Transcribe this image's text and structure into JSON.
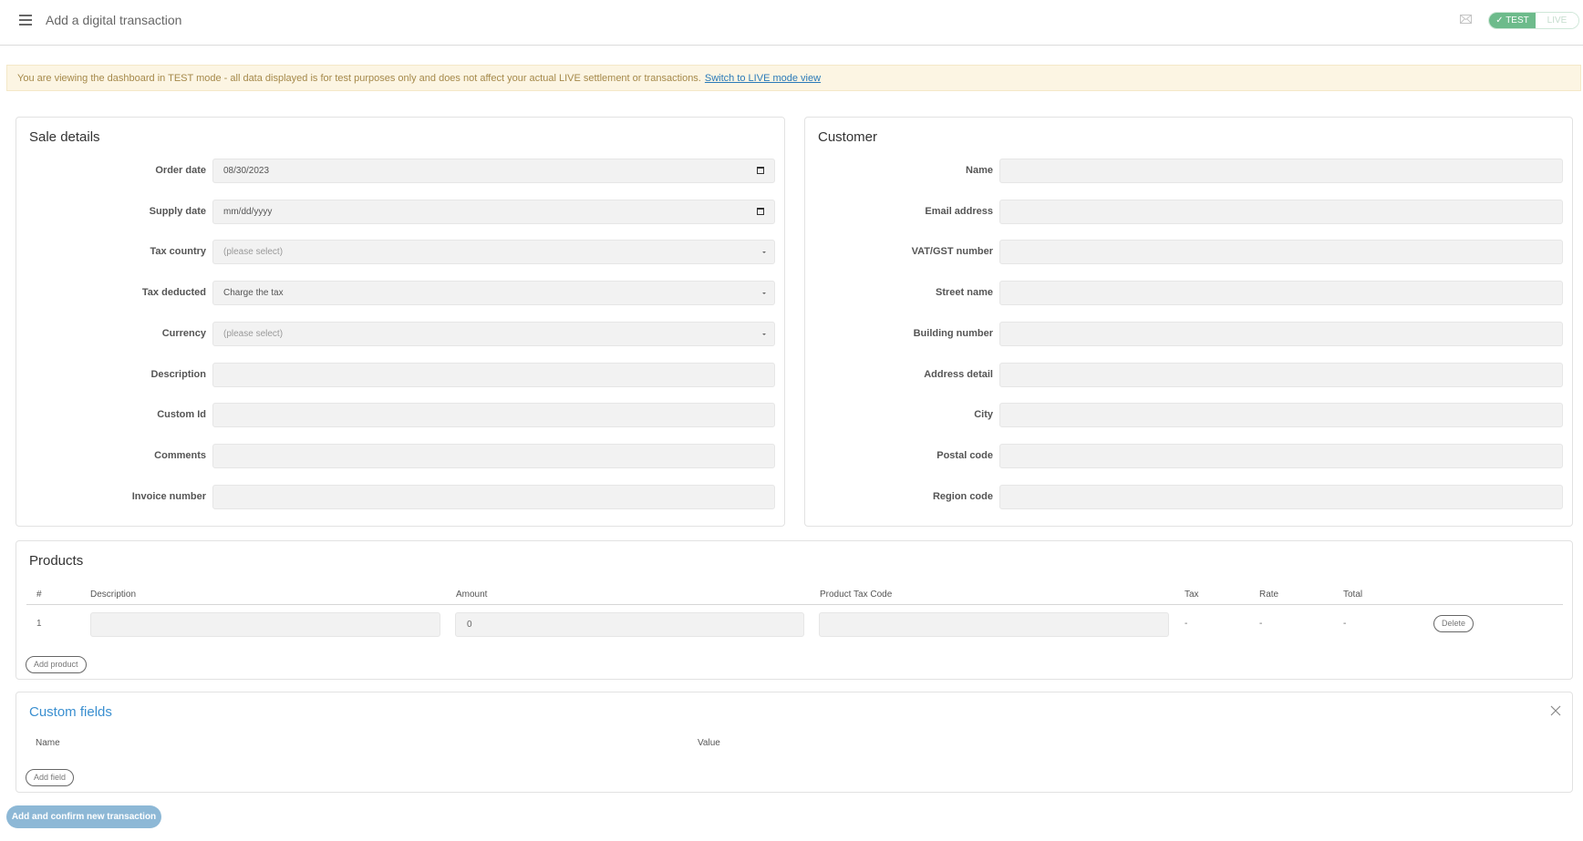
{
  "header": {
    "title": "Add a digital transaction",
    "menu_icon": "hamburger-menu-icon",
    "mail_icon": "envelope-icon",
    "mode_toggle": {
      "test_label": "✓ TEST",
      "live_label": "LIVE",
      "active": "TEST",
      "active_color": "#6dbb8b"
    }
  },
  "banner": {
    "text": "You are viewing the dashboard in TEST mode - all data displayed is for test purposes only and does not affect your actual LIVE settlement or transactions.",
    "link": "Switch to LIVE mode view"
  },
  "sale_details": {
    "title": "Sale details",
    "fields": [
      {
        "label": "Order date",
        "value": "08/30/2023",
        "type": "date"
      },
      {
        "label": "Supply date",
        "value": "mm/dd/yyyy",
        "type": "date"
      },
      {
        "label": "Tax country",
        "value": "(please select)",
        "type": "select"
      },
      {
        "label": "Tax deducted",
        "value": "Charge the tax",
        "type": "select"
      },
      {
        "label": "Currency",
        "value": "(please select)",
        "type": "select"
      },
      {
        "label": "Description",
        "value": "",
        "type": "text"
      },
      {
        "label": "Custom Id",
        "value": "",
        "type": "text"
      },
      {
        "label": "Comments",
        "value": "",
        "type": "text"
      },
      {
        "label": "Invoice number",
        "value": "",
        "type": "text"
      }
    ]
  },
  "customer": {
    "title": "Customer",
    "fields": [
      {
        "label": "Name",
        "value": ""
      },
      {
        "label": "Email address",
        "value": ""
      },
      {
        "label": "VAT/GST number",
        "value": ""
      },
      {
        "label": "Street name",
        "value": ""
      },
      {
        "label": "Building number",
        "value": ""
      },
      {
        "label": "Address detail",
        "value": ""
      },
      {
        "label": "City",
        "value": ""
      },
      {
        "label": "Postal code",
        "value": ""
      },
      {
        "label": "Region code",
        "value": ""
      }
    ]
  },
  "products": {
    "title": "Products",
    "columns": [
      "#",
      "Description",
      "Amount",
      "Product Tax Code",
      "Tax",
      "Rate",
      "Total"
    ],
    "rows": [
      {
        "num": "1",
        "description": "",
        "amount": "0",
        "tax_code": "",
        "tax": "-",
        "rate": "-",
        "total": "-",
        "delete_label": "Delete"
      }
    ],
    "add_label": "Add product"
  },
  "custom_fields": {
    "title": "Custom fields",
    "columns": [
      "Name",
      "Value"
    ],
    "add_label": "Add field",
    "close_icon": "close-icon"
  },
  "submit_label": "Add and confirm new transaction"
}
